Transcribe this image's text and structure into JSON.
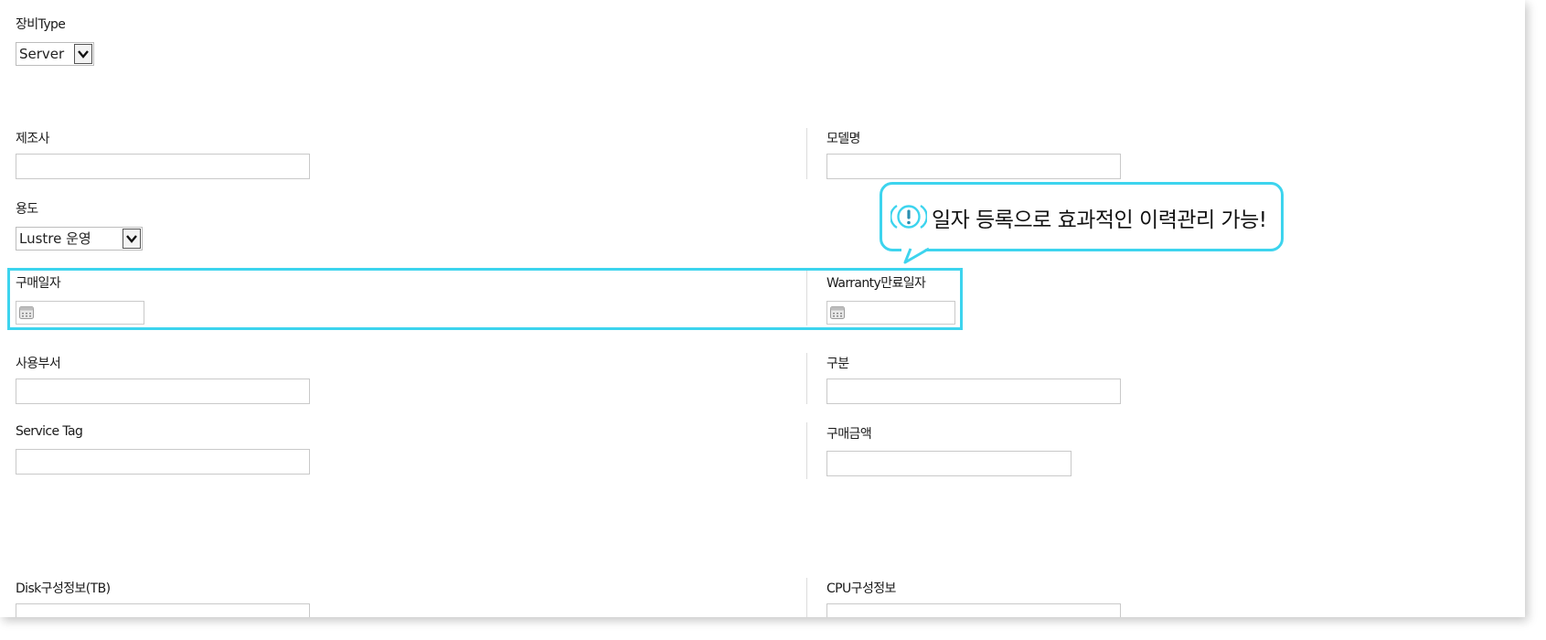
{
  "equipment_type": {
    "label": "장비Type",
    "selected": "Server"
  },
  "manufacturer": {
    "label": "제조사",
    "value": ""
  },
  "model_name": {
    "label": "모델명",
    "value": ""
  },
  "usage": {
    "label": "용도",
    "selected": "Lustre 운영"
  },
  "purchase_date": {
    "label": "구매일자",
    "value": ""
  },
  "warranty_end_date": {
    "label": "Warranty만료일자",
    "value": ""
  },
  "department": {
    "label": "사용부서",
    "value": ""
  },
  "category": {
    "label": "구분",
    "value": ""
  },
  "service_tag": {
    "label": "Service Tag",
    "value": ""
  },
  "purchase_amount": {
    "label": "구매금액",
    "value": ""
  },
  "disk_config": {
    "label": "Disk구성정보(TB)",
    "value": ""
  },
  "cpu_config": {
    "label": "CPU구성정보",
    "value": ""
  },
  "callout": {
    "text": "일자 등록으로 효과적인 이력관리 가능!",
    "icon": "exclamation-circle-icon"
  },
  "colors": {
    "highlight": "#3dd4ee",
    "field_border": "#c9c9c9",
    "divider": "#dcdcdc"
  }
}
